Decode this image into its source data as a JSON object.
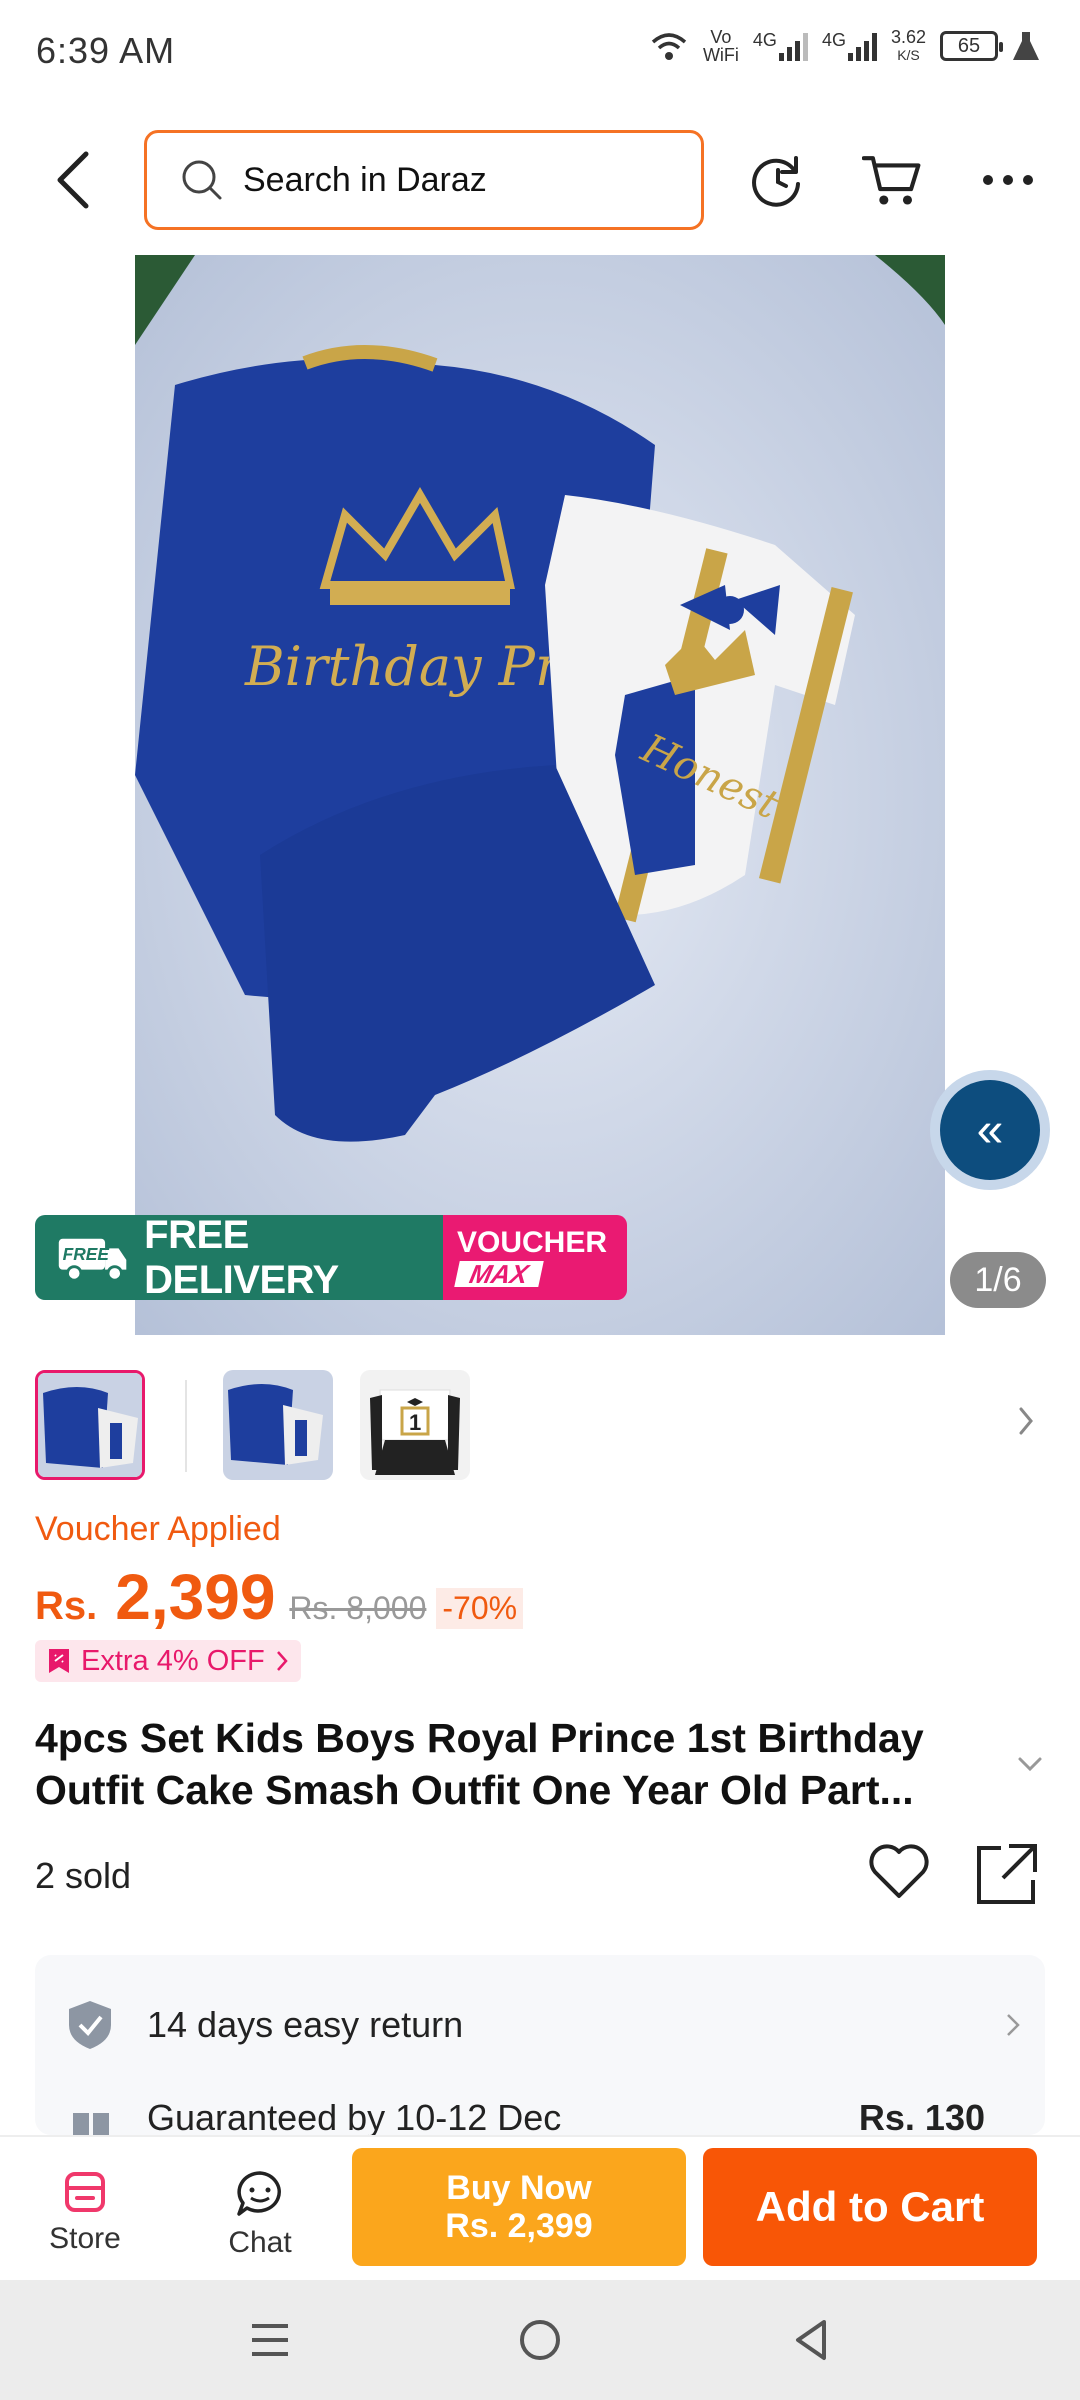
{
  "status_bar": {
    "time": "6:39 AM",
    "wifi_label_top": "Vo",
    "wifi_label_bottom": "WiFi",
    "net1": "4G",
    "net2": "4G",
    "speed_top": "3.62",
    "speed_bottom": "K/S",
    "battery": "65"
  },
  "search": {
    "placeholder": "Search in Daraz"
  },
  "gallery": {
    "counter": "1/6",
    "banner_free": "FREE DELIVERY",
    "banner_free_tag": "FREE",
    "banner_voucher_line1": "VOUCHER",
    "banner_voucher_line2": "MAX",
    "image_text_robe": "Birthday Prince",
    "image_text_onesie": "Honest"
  },
  "pricing": {
    "voucher_applied": "Voucher Applied",
    "currency": "Rs.",
    "price": "2,399",
    "original_price": "Rs. 8,000",
    "discount": "-70%",
    "extra_off": "Extra 4% OFF"
  },
  "product": {
    "title": "4pcs Set Kids Boys Royal Prince 1st Birthday Outfit Cake Smash Outfit One Year  Old Part...",
    "sold": "2 sold"
  },
  "info": {
    "return_text": "14 days easy return",
    "delivery_text": "Guaranteed by 10-12 Dec",
    "delivery_fee": "Rs. 130"
  },
  "bottom_bar": {
    "store_label": "Store",
    "chat_label": "Chat",
    "buy_now_line1": "Buy Now",
    "buy_now_line2": "Rs. 2,399",
    "add_to_cart": "Add to Cart"
  },
  "colors": {
    "accent": "#f85606",
    "buy_now": "#fba61c",
    "pink": "#e8196b"
  }
}
